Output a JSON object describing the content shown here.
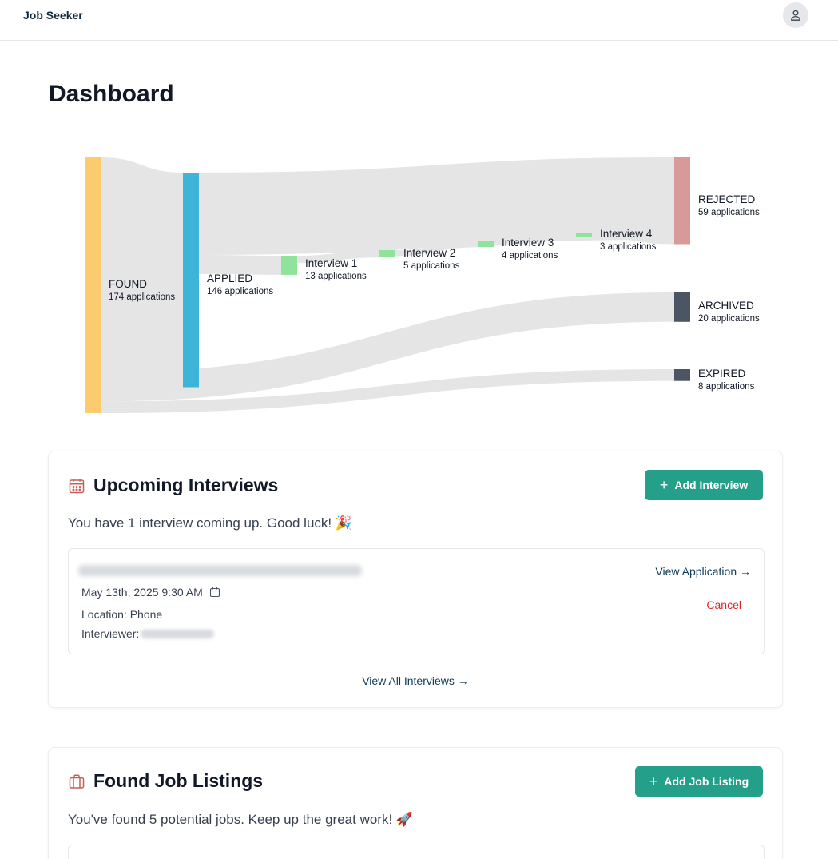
{
  "app": {
    "brand": "Job Seeker"
  },
  "page": {
    "title": "Dashboard"
  },
  "chart_data": {
    "type": "sankey",
    "nodes": [
      {
        "id": "found",
        "label": "FOUND",
        "sublabel": "174 applications",
        "value": 174,
        "color": "#fccb6e"
      },
      {
        "id": "applied",
        "label": "APPLIED",
        "sublabel": "146 applications",
        "value": 146,
        "color": "#40b3d8"
      },
      {
        "id": "int1",
        "label": "Interview 1",
        "sublabel": "13 applications",
        "value": 13,
        "color": "#8fe39a"
      },
      {
        "id": "int2",
        "label": "Interview 2",
        "sublabel": "5 applications",
        "value": 5,
        "color": "#8fe39a"
      },
      {
        "id": "int3",
        "label": "Interview 3",
        "sublabel": "4 applications",
        "value": 4,
        "color": "#8fe39a"
      },
      {
        "id": "int4",
        "label": "Interview 4",
        "sublabel": "3 applications",
        "value": 3,
        "color": "#8fe39a"
      },
      {
        "id": "rejected",
        "label": "REJECTED",
        "sublabel": "59 applications",
        "value": 59,
        "color": "#d89a98"
      },
      {
        "id": "archived",
        "label": "ARCHIVED",
        "sublabel": "20 applications",
        "value": 20,
        "color": "#4b5563"
      },
      {
        "id": "expired",
        "label": "EXPIRED",
        "sublabel": "8 applications",
        "value": 8,
        "color": "#4b5563"
      }
    ],
    "links": [
      {
        "source": "found",
        "target": "applied",
        "value": 146
      },
      {
        "source": "found",
        "target": "archived",
        "value": 20
      },
      {
        "source": "found",
        "target": "expired",
        "value": 8
      },
      {
        "source": "applied",
        "target": "rejected",
        "value": 56
      },
      {
        "source": "applied",
        "target": "int1",
        "value": 13
      },
      {
        "source": "int1",
        "target": "int2",
        "value": 5
      },
      {
        "source": "int2",
        "target": "int3",
        "value": 4
      },
      {
        "source": "int3",
        "target": "int4",
        "value": 3
      },
      {
        "source": "int4",
        "target": "rejected",
        "value": 3
      }
    ]
  },
  "interviews": {
    "title": "Upcoming Interviews",
    "add_button": "Add Interview",
    "summary": "You have 1 interview coming up. Good luck! 🎉",
    "item": {
      "date": "May 13th, 2025 9:30 AM",
      "location": "Location: Phone",
      "interviewer_label": "Interviewer:",
      "view_link": "View Application →",
      "cancel": "Cancel"
    },
    "view_all": "View All Interviews →"
  },
  "listings": {
    "title": "Found Job Listings",
    "add_button": "Add Job Listing",
    "summary": "You've found 5 potential jobs. Keep up the great work! 🚀"
  },
  "icons": {
    "avatar": "user-icon",
    "interviews": "calendar-icon",
    "listings": "briefcase-icon",
    "date": "calendar-icon"
  },
  "colors": {
    "accent": "#24a08a",
    "danger": "#dc2626",
    "link": "#0f3b57",
    "icon": "#c2615b"
  }
}
